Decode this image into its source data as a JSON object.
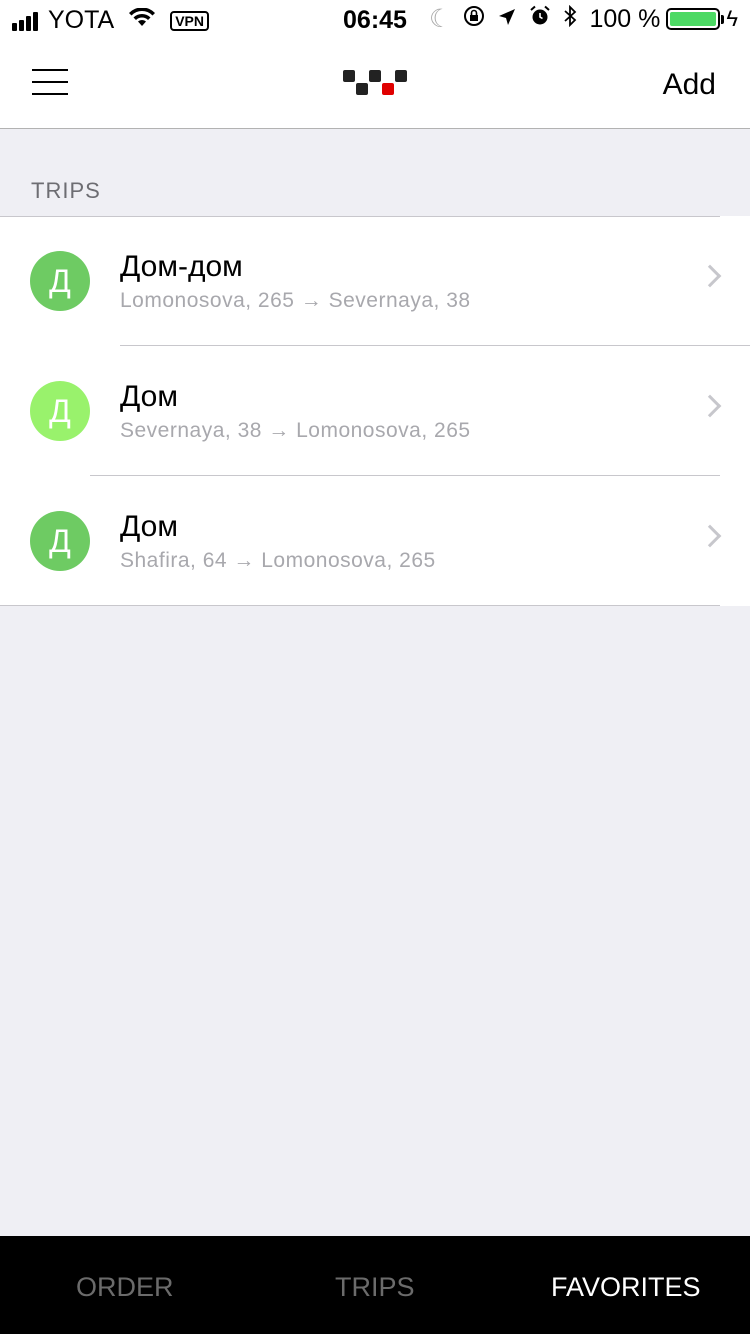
{
  "status_bar": {
    "carrier": "YOTA",
    "vpn": "VPN",
    "time": "06:45",
    "battery_percent": "100 %",
    "battery_level": 1.0,
    "battery_color": "#4cd964"
  },
  "nav": {
    "menu_icon": "hamburger-menu-icon",
    "logo_icon": "checkered-taxi-logo",
    "add_label": "Add"
  },
  "section": {
    "title": "TRIPS"
  },
  "trips": [
    {
      "avatar": "Д",
      "avatar_color": "#6ecb63",
      "title": "Дом-дом",
      "route": "Lomonosova, 265 → Severnaya, 38"
    },
    {
      "avatar": "Д",
      "avatar_color": "#99f26c",
      "title": "Дом",
      "route": "Severnaya, 38 → Lomonosova, 265"
    },
    {
      "avatar": "Д",
      "avatar_color": "#6ecb63",
      "title": "Дом",
      "route": "Shafira, 64 → Lomonosova, 265"
    }
  ],
  "tabs": [
    {
      "label": "ORDER",
      "active": false
    },
    {
      "label": "TRIPS",
      "active": false
    },
    {
      "label": "FAVORITES",
      "active": true
    }
  ],
  "colors": {
    "background": "#efeff4",
    "tab_bar": "#000000",
    "logo_accent": "#e00000"
  }
}
